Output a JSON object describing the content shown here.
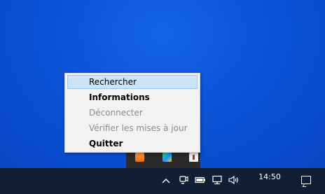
{
  "context_menu": {
    "items": [
      {
        "label": "Rechercher",
        "state": "highlighted"
      },
      {
        "label": "Informations",
        "state": "bold"
      },
      {
        "label": "Déconnecter",
        "state": "disabled"
      },
      {
        "label": "Vérifier les mises à jour",
        "state": "disabled"
      },
      {
        "label": "Quitter",
        "state": "bold"
      }
    ]
  },
  "taskbar": {
    "clock_time": "14:50",
    "clock_date": "",
    "tray_icons": [
      "chevron-up-icon",
      "meet-now-icon",
      "battery-icon",
      "network-icon",
      "speaker-icon"
    ],
    "action_center_icon": "notification-icon"
  },
  "colors": {
    "desktop": "#0b53d8",
    "taskbar": "#101f33",
    "menu_bg": "#f2f2f2",
    "menu_highlight": "#cce4f7",
    "menu_highlight_border": "#99c9ef",
    "disabled_text": "#8c8c8c"
  }
}
